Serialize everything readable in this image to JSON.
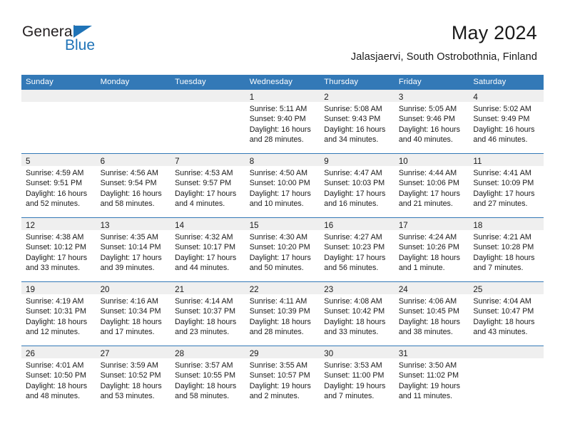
{
  "brand": {
    "name_part1": "General",
    "name_part2": "Blue"
  },
  "header": {
    "title": "May 2024",
    "subtitle": "Jalasjaervi, South Ostrobothnia, Finland"
  },
  "colors": {
    "header_blue": "#3379b7",
    "band_gray": "#efefef",
    "text": "#1a1a1a",
    "brand_blue": "#1f73b7"
  },
  "weekdays": [
    "Sunday",
    "Monday",
    "Tuesday",
    "Wednesday",
    "Thursday",
    "Friday",
    "Saturday"
  ],
  "labels": {
    "sunrise": "Sunrise:",
    "sunset": "Sunset:",
    "daylight": "Daylight:"
  },
  "weeks": [
    [
      {
        "day": "",
        "empty": true
      },
      {
        "day": "",
        "empty": true
      },
      {
        "day": "",
        "empty": true
      },
      {
        "day": "1",
        "sunrise": "Sunrise: 5:11 AM",
        "sunset": "Sunset: 9:40 PM",
        "daylight1": "Daylight: 16 hours",
        "daylight2": "and 28 minutes."
      },
      {
        "day": "2",
        "sunrise": "Sunrise: 5:08 AM",
        "sunset": "Sunset: 9:43 PM",
        "daylight1": "Daylight: 16 hours",
        "daylight2": "and 34 minutes."
      },
      {
        "day": "3",
        "sunrise": "Sunrise: 5:05 AM",
        "sunset": "Sunset: 9:46 PM",
        "daylight1": "Daylight: 16 hours",
        "daylight2": "and 40 minutes."
      },
      {
        "day": "4",
        "sunrise": "Sunrise: 5:02 AM",
        "sunset": "Sunset: 9:49 PM",
        "daylight1": "Daylight: 16 hours",
        "daylight2": "and 46 minutes."
      }
    ],
    [
      {
        "day": "5",
        "sunrise": "Sunrise: 4:59 AM",
        "sunset": "Sunset: 9:51 PM",
        "daylight1": "Daylight: 16 hours",
        "daylight2": "and 52 minutes."
      },
      {
        "day": "6",
        "sunrise": "Sunrise: 4:56 AM",
        "sunset": "Sunset: 9:54 PM",
        "daylight1": "Daylight: 16 hours",
        "daylight2": "and 58 minutes."
      },
      {
        "day": "7",
        "sunrise": "Sunrise: 4:53 AM",
        "sunset": "Sunset: 9:57 PM",
        "daylight1": "Daylight: 17 hours",
        "daylight2": "and 4 minutes."
      },
      {
        "day": "8",
        "sunrise": "Sunrise: 4:50 AM",
        "sunset": "Sunset: 10:00 PM",
        "daylight1": "Daylight: 17 hours",
        "daylight2": "and 10 minutes."
      },
      {
        "day": "9",
        "sunrise": "Sunrise: 4:47 AM",
        "sunset": "Sunset: 10:03 PM",
        "daylight1": "Daylight: 17 hours",
        "daylight2": "and 16 minutes."
      },
      {
        "day": "10",
        "sunrise": "Sunrise: 4:44 AM",
        "sunset": "Sunset: 10:06 PM",
        "daylight1": "Daylight: 17 hours",
        "daylight2": "and 21 minutes."
      },
      {
        "day": "11",
        "sunrise": "Sunrise: 4:41 AM",
        "sunset": "Sunset: 10:09 PM",
        "daylight1": "Daylight: 17 hours",
        "daylight2": "and 27 minutes."
      }
    ],
    [
      {
        "day": "12",
        "sunrise": "Sunrise: 4:38 AM",
        "sunset": "Sunset: 10:12 PM",
        "daylight1": "Daylight: 17 hours",
        "daylight2": "and 33 minutes."
      },
      {
        "day": "13",
        "sunrise": "Sunrise: 4:35 AM",
        "sunset": "Sunset: 10:14 PM",
        "daylight1": "Daylight: 17 hours",
        "daylight2": "and 39 minutes."
      },
      {
        "day": "14",
        "sunrise": "Sunrise: 4:32 AM",
        "sunset": "Sunset: 10:17 PM",
        "daylight1": "Daylight: 17 hours",
        "daylight2": "and 44 minutes."
      },
      {
        "day": "15",
        "sunrise": "Sunrise: 4:30 AM",
        "sunset": "Sunset: 10:20 PM",
        "daylight1": "Daylight: 17 hours",
        "daylight2": "and 50 minutes."
      },
      {
        "day": "16",
        "sunrise": "Sunrise: 4:27 AM",
        "sunset": "Sunset: 10:23 PM",
        "daylight1": "Daylight: 17 hours",
        "daylight2": "and 56 minutes."
      },
      {
        "day": "17",
        "sunrise": "Sunrise: 4:24 AM",
        "sunset": "Sunset: 10:26 PM",
        "daylight1": "Daylight: 18 hours",
        "daylight2": "and 1 minute."
      },
      {
        "day": "18",
        "sunrise": "Sunrise: 4:21 AM",
        "sunset": "Sunset: 10:28 PM",
        "daylight1": "Daylight: 18 hours",
        "daylight2": "and 7 minutes."
      }
    ],
    [
      {
        "day": "19",
        "sunrise": "Sunrise: 4:19 AM",
        "sunset": "Sunset: 10:31 PM",
        "daylight1": "Daylight: 18 hours",
        "daylight2": "and 12 minutes."
      },
      {
        "day": "20",
        "sunrise": "Sunrise: 4:16 AM",
        "sunset": "Sunset: 10:34 PM",
        "daylight1": "Daylight: 18 hours",
        "daylight2": "and 17 minutes."
      },
      {
        "day": "21",
        "sunrise": "Sunrise: 4:14 AM",
        "sunset": "Sunset: 10:37 PM",
        "daylight1": "Daylight: 18 hours",
        "daylight2": "and 23 minutes."
      },
      {
        "day": "22",
        "sunrise": "Sunrise: 4:11 AM",
        "sunset": "Sunset: 10:39 PM",
        "daylight1": "Daylight: 18 hours",
        "daylight2": "and 28 minutes."
      },
      {
        "day": "23",
        "sunrise": "Sunrise: 4:08 AM",
        "sunset": "Sunset: 10:42 PM",
        "daylight1": "Daylight: 18 hours",
        "daylight2": "and 33 minutes."
      },
      {
        "day": "24",
        "sunrise": "Sunrise: 4:06 AM",
        "sunset": "Sunset: 10:45 PM",
        "daylight1": "Daylight: 18 hours",
        "daylight2": "and 38 minutes."
      },
      {
        "day": "25",
        "sunrise": "Sunrise: 4:04 AM",
        "sunset": "Sunset: 10:47 PM",
        "daylight1": "Daylight: 18 hours",
        "daylight2": "and 43 minutes."
      }
    ],
    [
      {
        "day": "26",
        "sunrise": "Sunrise: 4:01 AM",
        "sunset": "Sunset: 10:50 PM",
        "daylight1": "Daylight: 18 hours",
        "daylight2": "and 48 minutes."
      },
      {
        "day": "27",
        "sunrise": "Sunrise: 3:59 AM",
        "sunset": "Sunset: 10:52 PM",
        "daylight1": "Daylight: 18 hours",
        "daylight2": "and 53 minutes."
      },
      {
        "day": "28",
        "sunrise": "Sunrise: 3:57 AM",
        "sunset": "Sunset: 10:55 PM",
        "daylight1": "Daylight: 18 hours",
        "daylight2": "and 58 minutes."
      },
      {
        "day": "29",
        "sunrise": "Sunrise: 3:55 AM",
        "sunset": "Sunset: 10:57 PM",
        "daylight1": "Daylight: 19 hours",
        "daylight2": "and 2 minutes."
      },
      {
        "day": "30",
        "sunrise": "Sunrise: 3:53 AM",
        "sunset": "Sunset: 11:00 PM",
        "daylight1": "Daylight: 19 hours",
        "daylight2": "and 7 minutes."
      },
      {
        "day": "31",
        "sunrise": "Sunrise: 3:50 AM",
        "sunset": "Sunset: 11:02 PM",
        "daylight1": "Daylight: 19 hours",
        "daylight2": "and 11 minutes."
      },
      {
        "day": "",
        "empty": true
      }
    ]
  ]
}
